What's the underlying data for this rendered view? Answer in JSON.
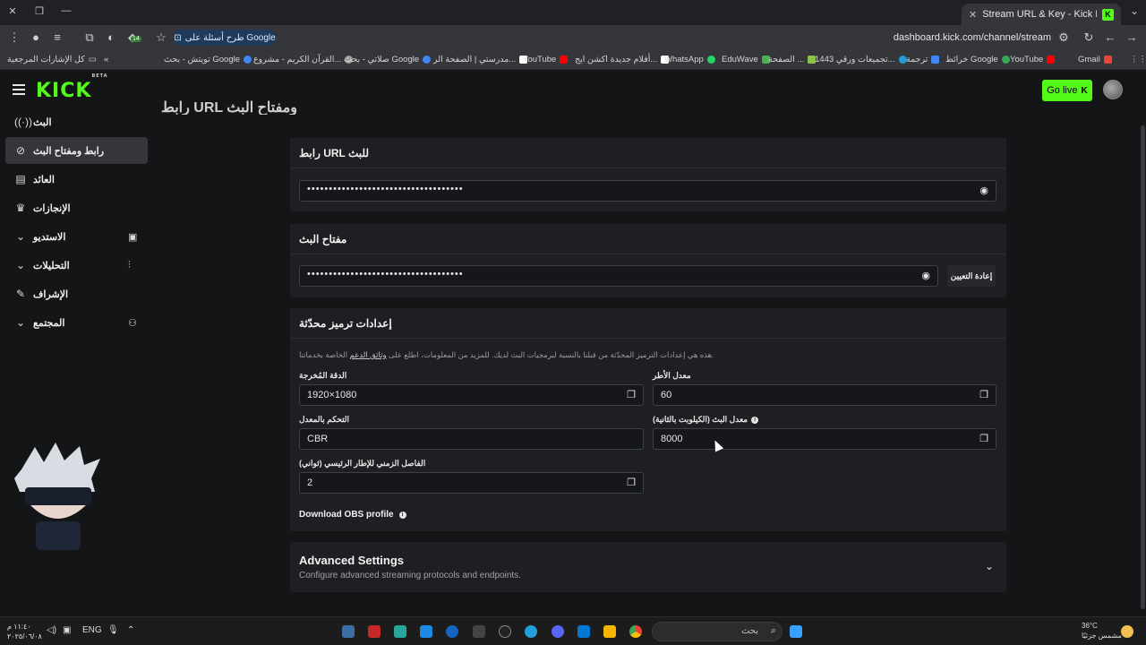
{
  "browser": {
    "tab_title": "Stream URL & Key - Kick Dashb",
    "url": "dashboard.kick.com/channel/stream",
    "ask_google": "طرح أسئلة على Google",
    "extension_badge": "14",
    "bookmarks": [
      {
        "label": "Gmail",
        "color": "#ea4335"
      },
      {
        "label": "YouTube",
        "color": "#ff0000"
      },
      {
        "label": "خرائط Google",
        "color": "#34a853"
      },
      {
        "label": "ترجمة",
        "color": "#4285f4"
      },
      {
        "label": "تجميعات ورقي 1443...",
        "color": "#229ed9"
      },
      {
        "label": "الصفحة ...",
        "color": "#8bc34a"
      },
      {
        "label": "EduWave",
        "color": "#4caf50"
      },
      {
        "label": "WhatsApp",
        "color": "#25d366"
      },
      {
        "label": "أفلام جديدة اكشن ايج...",
        "color": "#ffffff"
      },
      {
        "label": "YouTube",
        "color": "#ff0000"
      },
      {
        "label": "مدرستي | الصفحة الر...",
        "color": "#ffffff"
      },
      {
        "label": "صلاتي - بحث Google",
        "color": "#4285f4"
      },
      {
        "label": "القرآن الكريم - مشروع...",
        "color": "#9e9e9e"
      },
      {
        "label": "تويتش - بحث Google",
        "color": "#4285f4"
      }
    ],
    "all_bookmarks": "كل الإشارات المرجعية"
  },
  "header": {
    "logo": "KICK",
    "logo_badge": "BETA",
    "go_live": "Go live",
    "go_live_k": "K"
  },
  "sidebar": {
    "items": [
      {
        "label": "البث",
        "icon": "broadcast-icon"
      },
      {
        "label": "رابط ومفتاح البث",
        "icon": "link-icon"
      },
      {
        "label": "العائد",
        "icon": "chart-icon"
      },
      {
        "label": "الإنجازات",
        "icon": "trophy-icon"
      },
      {
        "label": "الاستديو",
        "icon": "studio-icon"
      },
      {
        "label": "التحليلات",
        "icon": "analytics-icon"
      },
      {
        "label": "الإشراف",
        "icon": "wrench-icon"
      },
      {
        "label": "المجتمع",
        "icon": "community-icon"
      }
    ]
  },
  "main": {
    "page_title": "رابط URL ومفتاح البث",
    "url_card": {
      "title": "رابط URL للبث",
      "value": "••••••••••••••••••••••••••••••••••••"
    },
    "key_card": {
      "title": "مفتاح البث",
      "value": "••••••••••••••••••••••••••••••••••••",
      "reset": "إعادة التعيين"
    },
    "encoding": {
      "title": "إعدادات ترميز محدّثة",
      "desc_a": "هذه هي إعدادات الترميز المحدّثة من قبلنا بالنسبة لبرمجيات البث لديك. للمزيد من المعلومات، اطلع على",
      "desc_link": "وثائق الدعم",
      "desc_b": "الخاصة بخدماتنا.",
      "fields": {
        "resolution": {
          "label": "الدقة المُخرجة",
          "value": "1920×1080"
        },
        "fps": {
          "label": "معدل الأطر",
          "value": "60"
        },
        "rate_control": {
          "label": "التحكم بالمعدل",
          "value": "CBR"
        },
        "bitrate": {
          "label": "معدل البث (الكيلوبت بالثانية)",
          "value": "8000"
        },
        "keyframe": {
          "label": "الفاصل الزمني للإطار الرئيسي (ثواني)",
          "value": "2"
        }
      },
      "obs": "Download OBS profile"
    },
    "advanced": {
      "title": "Advanced Settings",
      "subtitle": "Configure advanced streaming protocols and endpoints."
    }
  },
  "taskbar": {
    "search": "بحث",
    "lang": "ENG",
    "time": "١١:٤٠ م",
    "date": "٢٠٢٥/٠٦/٠٨",
    "temp": "36°C",
    "weather": "مشمس جزئيًا"
  }
}
